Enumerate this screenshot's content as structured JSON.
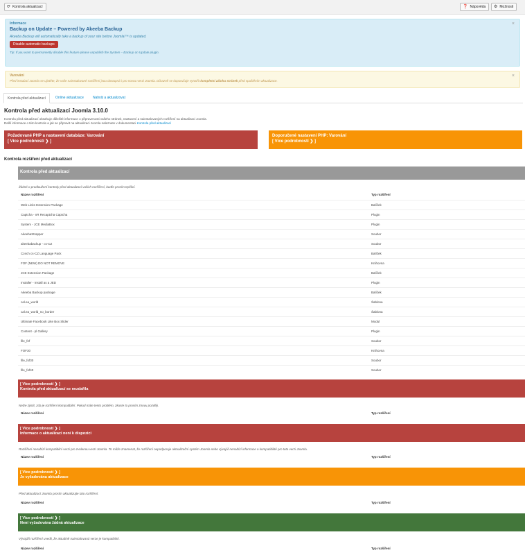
{
  "toolbar": {
    "check_updates": "Kontrola aktualizací",
    "help": "Nápověda",
    "options": "Možnosti"
  },
  "info_alert": {
    "heading": "Informace",
    "title": "Backup on Update – Powered by Akeeba Backup",
    "text": "Akeeba Backup will automatically take a backup of your site before Joomla!™ is updated.",
    "button": "Disable automatic backups",
    "note": "Tip: If you want to permanently disable this feature please unpublish the System – Backup on Update plugin."
  },
  "warn_alert": {
    "heading": "Varování",
    "text_start": "Před instalací Joomla se ujistěte, že vaše nainstalované rozšíření jsou dostupná i pro novou verzi Joomla. Důrazně se doporučuje vytvořit ",
    "text_bold": "kompletní zálohu stránek",
    "text_end": " před spuštěním aktualizace."
  },
  "tabs": [
    "Kontrola před aktualizací",
    "Online aktualizace",
    "Nahrát a aktualizovat"
  ],
  "main": {
    "title": "Kontrola před aktualizací Joomla 3.10.0",
    "intro_line1": "Kontrola před aktualizací obsahuje důležité informace o připravenosti vašeho stránek, nastavení a nainstalovaných rozšíření na aktualizaci Joomla.",
    "intro_line2": "Další informace o této kontrole a jak se připravit na aktualizaci Joomla naleznete v dokumentaci ",
    "intro_link": "Kontrola před aktualizací",
    "box_required": "Požadované PHP a nastavení databáze: Varování",
    "box_recommended": "Doporučené nastavení PHP: Varování",
    "more_details": "[ Více podrobností ❯ ]",
    "ext_heading": "Kontrola rozšíření před aktualizací"
  },
  "preupdate": {
    "header": "Kontrola před aktualizací",
    "desc": "Žádné o prodloužení kontroly před aktualizací vašich rozšíření, budťe prosím trpěliví.",
    "col_name": "Název rozšíření",
    "col_type": "Typ rozšíření",
    "rows": [
      [
        "Web Links Extension Package",
        "Balíček"
      ],
      [
        "Captcha - nR Recaptcha Captcha",
        "Plugin"
      ],
      [
        "System - JCE MediaBox",
        "Plugin"
      ],
      [
        "AkeebaStrapper",
        "Soubor"
      ],
      [
        "akeebabackup - cs-CZ",
        "Soubor"
      ],
      [
        "Czech cs-CZ Language Pack",
        "Balíček"
      ],
      [
        "FOF (NEW) DO NOT REMOVE",
        "Knihovna"
      ],
      [
        "JCE Extension Package",
        "Balíček"
      ],
      [
        "Installer - Install as a JED",
        "Plugin"
      ],
      [
        "Akeeba Backup package",
        "Balíček"
      ],
      [
        "cal.ea_world",
        "Šablona"
      ],
      [
        "cal.ea_world_no_border",
        "Šablona"
      ],
      [
        "Ultimate Facebook Like Box Slider",
        "Modul"
      ],
      [
        "Content - pl Gallery",
        "Plugin"
      ],
      [
        "file_fef",
        "Soubor"
      ],
      [
        "FOF30",
        "Knihovna"
      ],
      [
        "file_fof30",
        "Soubor"
      ],
      [
        "file_fof40",
        "Soubor"
      ]
    ]
  },
  "sections": [
    {
      "more": "[ Více podrobností ❯ ]",
      "title": "Kontrola před aktualizací se nezdařila",
      "desc": "Nelze zjistit, zda je rozšíření kompatibilní. Pokud máte tento problém, zkuste to prosím znovu později."
    },
    {
      "more": "[ Více podrobností ❯ ]",
      "title": "Informace o aktualizaci není k dispozici",
      "desc": "Rozšíření nenabízí kompatibilní verzi pro zvolenou verzi Joomla. To může znamenat, že rozšíření nepodporuje aktualizační systém Joomla nebo vývojář nenabízí informace o kompatibilitě pro tuto verzi Joomla."
    },
    {
      "more": "[ Více podrobností ❯ ]",
      "title": "Je vyžadována aktualizace",
      "desc": "Před aktualizací Joomla prosím aktualizujte tato rozšíření."
    },
    {
      "more": "[ Více podrobností ❯ ]",
      "title": "Není vyžadována žádná aktualizace",
      "desc": "Vývojáři rozšíření uvedli, že aktuálně nainstalovaná verze je kompatibilní."
    }
  ],
  "colors": {
    "info_bg": "#d9edf7",
    "warn_bg": "#fcf8e3",
    "red": "#b7433e",
    "orange": "#f89406",
    "green": "#43773b",
    "grey": "#999999"
  }
}
